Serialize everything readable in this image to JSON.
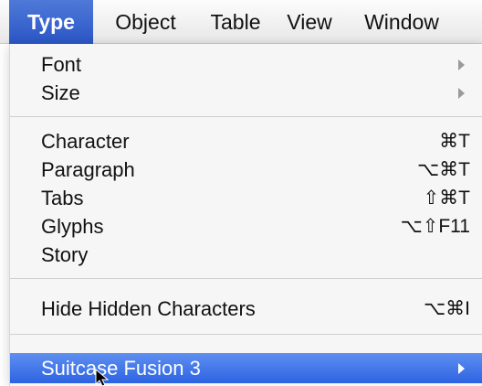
{
  "menubar": {
    "items": [
      {
        "label": "Type"
      },
      {
        "label": "Object"
      },
      {
        "label": "Table"
      },
      {
        "label": "View"
      },
      {
        "label": "Window"
      }
    ],
    "active": "Type"
  },
  "type_menu": {
    "items": [
      {
        "label": "Font",
        "shortcut": "",
        "submenu": true
      },
      {
        "label": "Size",
        "shortcut": "",
        "submenu": true
      },
      {
        "label": "Character",
        "shortcut": "⌘T",
        "submenu": false
      },
      {
        "label": "Paragraph",
        "shortcut": "⌥⌘T",
        "submenu": false
      },
      {
        "label": "Tabs",
        "shortcut": "⇧⌘T",
        "submenu": false
      },
      {
        "label": "Glyphs",
        "shortcut": "⌥⇧F11",
        "submenu": false
      },
      {
        "label": "Story",
        "shortcut": "",
        "submenu": false
      },
      {
        "label": "Hide Hidden Characters",
        "shortcut": "⌥⌘I",
        "submenu": false
      },
      {
        "label": "Suitcase Fusion 3",
        "shortcut": "",
        "submenu": true,
        "highlighted": true
      }
    ]
  },
  "icons": {
    "submenu": "chevron-right-icon",
    "cursor": "pointer-cursor-icon"
  },
  "colors": {
    "highlight": "#2d63e2",
    "menubar_active": "#3b67d3",
    "menu_bg": "#f6f6f6",
    "text": "#111111"
  }
}
